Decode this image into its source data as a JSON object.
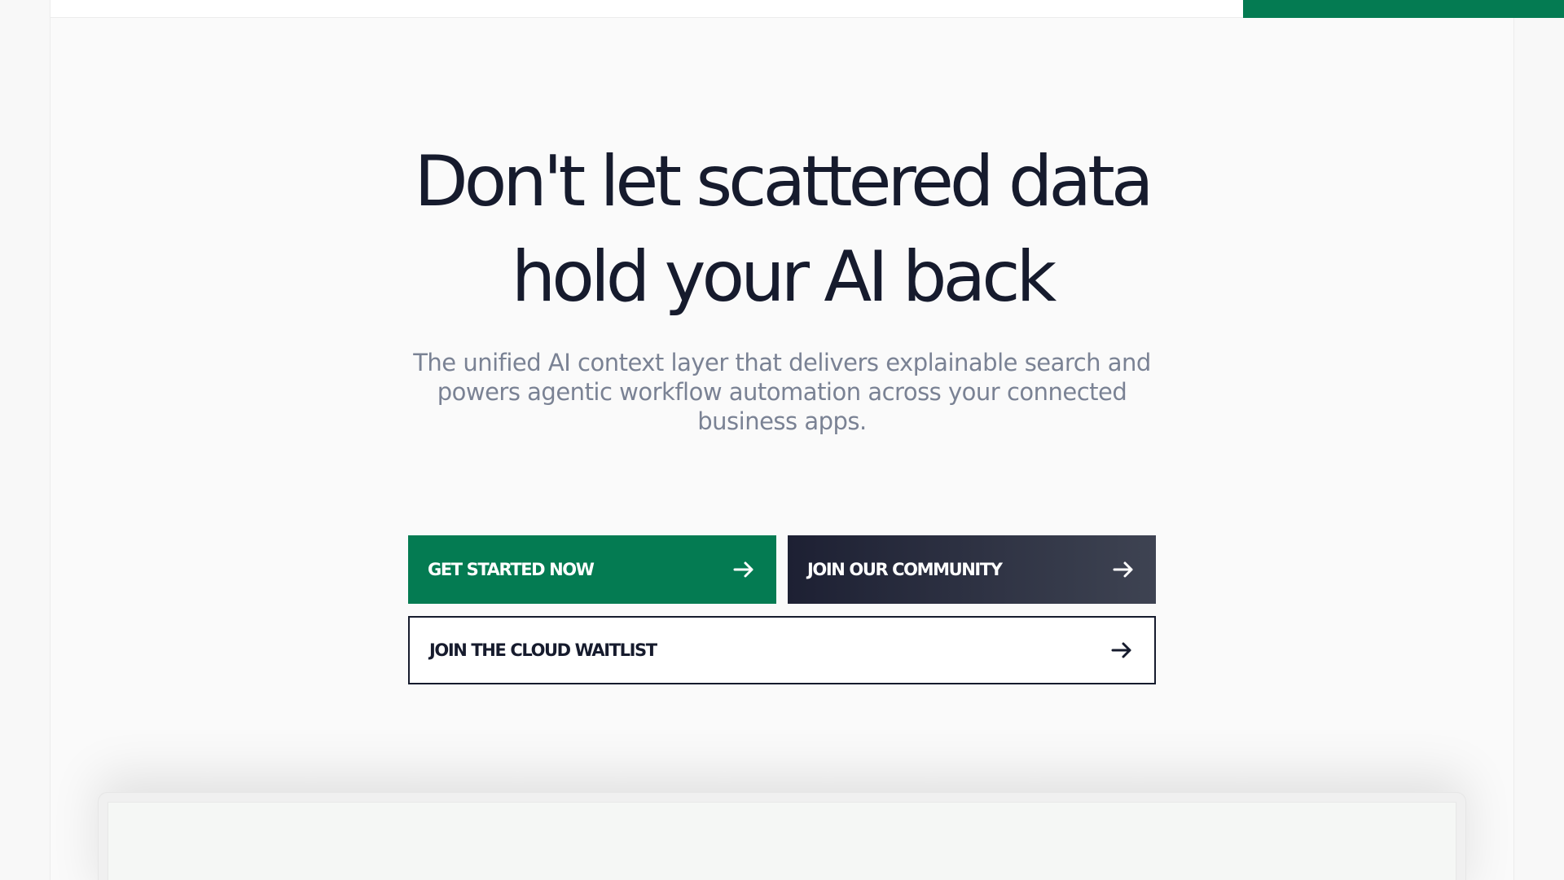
{
  "hero": {
    "title_line1": "Don't let scattered data",
    "title_line2": "hold your AI back",
    "subtitle": "The unified AI context layer that delivers explainable search and powers agentic workflow automation across your connected business apps."
  },
  "cta": {
    "get_started": "GET STARTED NOW",
    "join_community": "JOIN OUR COMMUNITY",
    "cloud_waitlist": "JOIN THE CLOUD WAITLIST"
  },
  "icons": {
    "cta_arrow": "arrow-right-icon"
  },
  "colors": {
    "brand_green": "#047b52",
    "dark_button": "#1d2033",
    "heading_text": "#161b2d",
    "subtitle_text": "#7a8294"
  }
}
